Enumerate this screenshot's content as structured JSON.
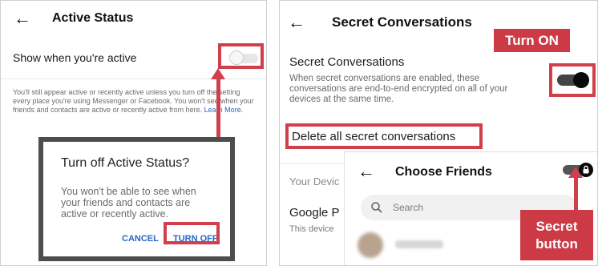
{
  "left": {
    "title": "Active Status",
    "show_label": "Show when you're active",
    "description": "You'll still appear active or recently active unless you turn off the setting every place you're using Messenger or Facebook. You won't see when your friends and contacts are active or recently active from here.",
    "learn_more": "Learn More.",
    "dialog": {
      "title": "Turn off Active Status?",
      "body": "You won't be able to see when your friends and contacts are active or recently active.",
      "cancel": "CANCEL",
      "turn_off": "TURN OFF"
    }
  },
  "right": {
    "title": "Secret Conversations",
    "turn_on_callout": "Turn ON",
    "secret_label": "Secret Conversations",
    "secret_desc": "When secret conversations are enabled, these conversations are end-to-end encrypted on all of your devices at the same time.",
    "delete_label": "Delete all secret conversations",
    "your_devices": "Your Devic",
    "google_label": "Google P",
    "this_device": "This device",
    "choose_friends": {
      "title": "Choose Friends",
      "search_placeholder": "Search"
    },
    "secret_button_callout": "Secret button"
  },
  "colors": {
    "accent_red": "#d0404c",
    "link_blue": "#2a64c5"
  },
  "icons": [
    "back-arrow-icon",
    "search-icon",
    "lock-icon"
  ]
}
